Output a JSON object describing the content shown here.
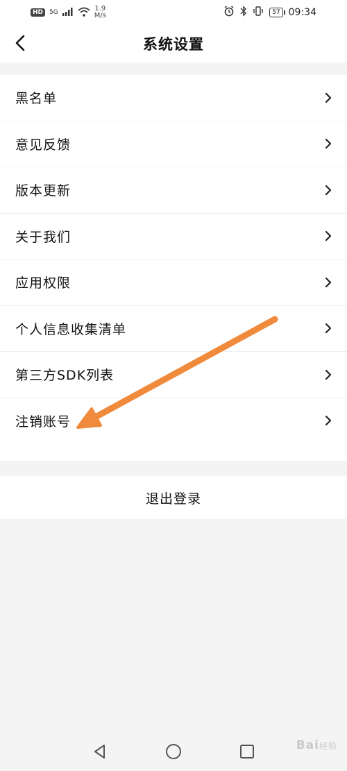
{
  "status_bar": {
    "hd": "HD",
    "network": "5G",
    "speed_value": "1.9",
    "speed_unit": "M/s",
    "battery": "57",
    "time": "09:34"
  },
  "header": {
    "title": "系统设置"
  },
  "menu": {
    "items": [
      {
        "label": "黑名单"
      },
      {
        "label": "意见反馈"
      },
      {
        "label": "版本更新"
      },
      {
        "label": "关于我们"
      },
      {
        "label": "应用权限"
      },
      {
        "label": "个人信息收集清单"
      },
      {
        "label": "第三方SDK列表"
      },
      {
        "label": "注销账号"
      }
    ]
  },
  "logout": {
    "label": "退出登录"
  },
  "annotation": {
    "color": "#f08a3c"
  },
  "watermark": {
    "text": "Bai",
    "suffix": "经验"
  }
}
